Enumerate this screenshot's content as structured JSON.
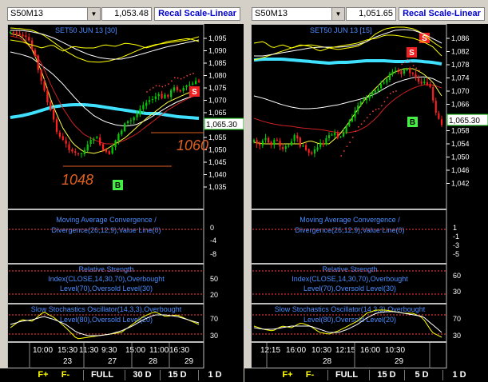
{
  "left": {
    "symbol": "S50M13",
    "last_price": "1,053.48",
    "recal_label": "Recal Scale-Linear",
    "chart_title": "SET50 JUN 13   [30]",
    "y_ticks": [
      "1,095",
      "1,090",
      "1,085",
      "1,080",
      "1,075",
      "1,070",
      "1,065",
      "1,060",
      "1,055",
      "1,050",
      "1,045",
      "1,040",
      "1,035"
    ],
    "current_price_tag": "1,065.30",
    "annotation_1060": "1060",
    "annotation_1048": "1048",
    "signal_buy": "B",
    "signal_sell": "S",
    "macd_title_1": "Moving Average Convergence /",
    "macd_title_2": "Divergence(26,12,9),Value Line(0)",
    "macd_ticks": [
      "0",
      "-4",
      "-8"
    ],
    "rsi_title_1": "Relative Strength",
    "rsi_title_2": "Index(CLOSE,14,30,70),Overbought",
    "rsi_title_3": "Level(70),Oversold Level(30)",
    "rsi_ticks": [
      "50",
      "20"
    ],
    "stoch_title_1": "Slow Stochastics Oscillator(14,3,3),Overbought",
    "stoch_title_2": "Level(80),Oversold Level(20)",
    "stoch_ticks": [
      "70",
      "30"
    ],
    "time_labels": [
      "10:00",
      "15:30",
      "11:30",
      "9:30",
      "15:00",
      "11:00",
      "16:30"
    ],
    "date_labels": [
      "23",
      "27",
      "28",
      "29"
    ]
  },
  "right": {
    "symbol": "S50M13",
    "last_price": "1,051.65",
    "recal_label": "Recal Scale-Linear",
    "chart_title": "SET50 JUN 13   [15]",
    "y_ticks": [
      "1,086",
      "1,082",
      "1,078",
      "1,074",
      "1,070",
      "1,066",
      "1,062",
      "1,058",
      "1,054",
      "1,050",
      "1,046",
      "1,042"
    ],
    "current_price_tag": "1,065.30",
    "signal_buy": "B",
    "signal_sell": "S",
    "macd_title_1": "Moving Average Convergence /",
    "macd_title_2": "Divergence(26,12,9),Value Line(0)",
    "macd_ticks": [
      "1",
      "-1",
      "-3",
      "-5"
    ],
    "rsi_title_1": "Relative Strength",
    "rsi_title_2": "Index(CLOSE,14,30,70),Overbought",
    "rsi_title_3": "Level(70),Oversold Level(30)",
    "rsi_ticks": [
      "60",
      "30"
    ],
    "stoch_title_1": "Slow Stochastics Oscillator(14,3,3),Overbought",
    "stoch_title_2": "Level(80),Oversold Level(20)",
    "stoch_ticks": [
      "70",
      "30"
    ],
    "time_labels": [
      "12:15",
      "16:00",
      "10:30",
      "12:15",
      "16:00",
      "10:30"
    ],
    "date_labels": [
      "28",
      "29"
    ]
  },
  "bottom_left": [
    "F+",
    "F-",
    "FULL",
    "30 D",
    "15 D",
    "1 D"
  ],
  "bottom_right": [
    "F+",
    "F-",
    "FULL",
    "15 D",
    "5 D",
    "1 D"
  ],
  "colors": {
    "up": "#00cc00",
    "down": "#ff2020",
    "ma_cyan": "#40e0ff",
    "ma_white": "#ffffff",
    "ma_yellow": "#ffff40",
    "ma_red": "#cc2222",
    "ind_yellow": "#ffff00",
    "title_blue": "#4a8cff"
  }
}
